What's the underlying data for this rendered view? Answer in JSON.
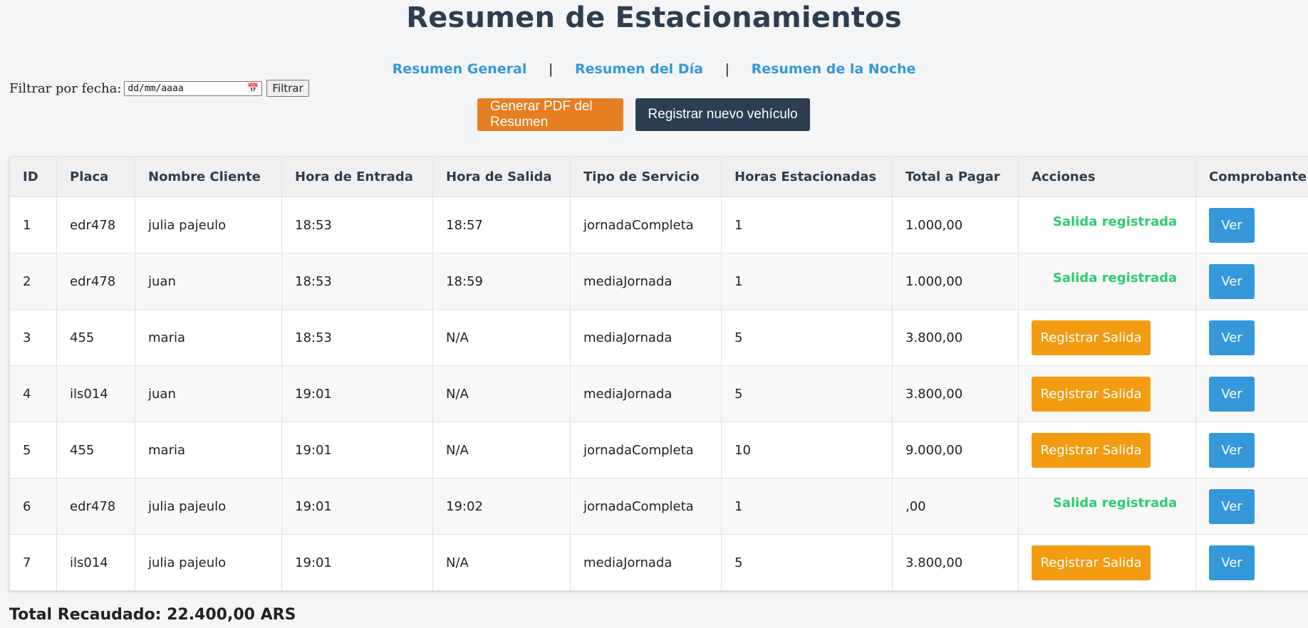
{
  "page": {
    "title": "Resumen de Estacionamientos",
    "filter_label": "Filtrar por fecha:",
    "date_placeholder": "dd/mm/aaaa",
    "filter_button": "Filtrar"
  },
  "nav": {
    "general": "Resumen General",
    "separator": "|",
    "day": "Resumen del Día",
    "night": "Resumen de la Noche"
  },
  "toolbar": {
    "pdf_button": "Generar PDF del Resumen",
    "register_button": "Registrar nuevo vehículo"
  },
  "table": {
    "headers": [
      "ID",
      "Placa",
      "Nombre Cliente",
      "Hora de Entrada",
      "Hora de Salida",
      "Tipo de Servicio",
      "Horas Estacionadas",
      "Total a Pagar",
      "Acciones",
      "Comprobante"
    ],
    "rows": [
      {
        "id": "1",
        "placa": "edr478",
        "cliente": "julia pajeulo",
        "entrada": "18:53",
        "salida": "18:57",
        "servicio": "jornadaCompleta",
        "horas": "1",
        "total": "1.000,00",
        "accion": "Salida registrada",
        "comprobante": "Ver"
      },
      {
        "id": "2",
        "placa": "edr478",
        "cliente": "juan",
        "entrada": "18:53",
        "salida": "18:59",
        "servicio": "mediaJornada",
        "horas": "1",
        "total": "1.000,00",
        "accion": "Salida registrada",
        "comprobante": "Ver"
      },
      {
        "id": "3",
        "placa": "455",
        "cliente": "maria",
        "entrada": "18:53",
        "salida": "N/A",
        "servicio": "mediaJornada",
        "horas": "5",
        "total": "3.800,00",
        "accion": "Registrar Salida",
        "comprobante": "Ver"
      },
      {
        "id": "4",
        "placa": "ils014",
        "cliente": "juan",
        "entrada": "19:01",
        "salida": "N/A",
        "servicio": "mediaJornada",
        "horas": "5",
        "total": "3.800,00",
        "accion": "Registrar Salida",
        "comprobante": "Ver"
      },
      {
        "id": "5",
        "placa": "455",
        "cliente": "maria",
        "entrada": "19:01",
        "salida": "N/A",
        "servicio": "jornadaCompleta",
        "horas": "10",
        "total": "9.000,00",
        "accion": "Registrar Salida",
        "comprobante": "Ver"
      },
      {
        "id": "6",
        "placa": "edr478",
        "cliente": "julia pajeulo",
        "entrada": "19:01",
        "salida": "19:02",
        "servicio": "jornadaCompleta",
        "horas": "1",
        "total": ",00",
        "accion": "Salida registrada",
        "comprobante": "Ver"
      },
      {
        "id": "7",
        "placa": "ils014",
        "cliente": "julia pajeulo",
        "entrada": "19:01",
        "salida": "N/A",
        "servicio": "mediaJornada",
        "horas": "5",
        "total": "3.800,00",
        "accion": "Registrar Salida",
        "comprobante": "Ver"
      }
    ]
  },
  "footer": {
    "total": "Total Recaudado: 22.400,00 ARS"
  },
  "colors": {
    "title": "#2c3e50",
    "link": "#3498db",
    "pdf_button": "#e67e22",
    "register_button": "#2c3e50",
    "salida_button": "#f39c12",
    "ver_button": "#3498db",
    "done_text": "#2ecc71"
  }
}
